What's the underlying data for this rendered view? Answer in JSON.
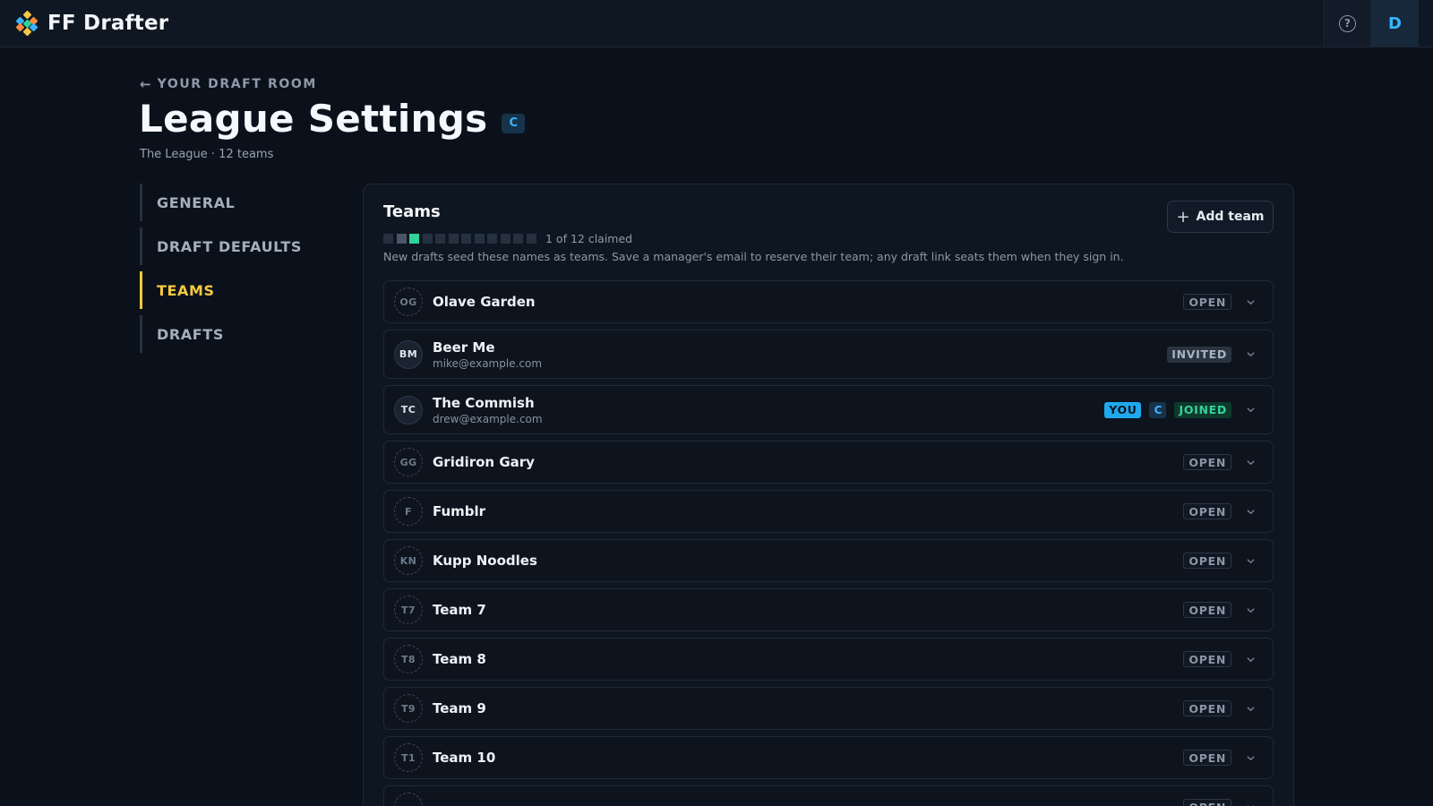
{
  "app": {
    "name": "FF Drafter",
    "avatar_initial": "D",
    "help_glyph": "?",
    "brand_colors": [
      "#ff8a3d",
      "#3cb2ff",
      "#f5c842",
      "#2fd398"
    ]
  },
  "header": {
    "back_label": "YOUR DRAFT ROOM",
    "back_icon": "arrow-left-icon",
    "title": "League Settings",
    "title_badge": "C",
    "subtitle": "The League · 12 teams"
  },
  "nav": {
    "items": [
      {
        "label": "GENERAL",
        "active": false
      },
      {
        "label": "DRAFT DEFAULTS",
        "active": false
      },
      {
        "label": "TEAMS",
        "active": true
      },
      {
        "label": "DRAFTS",
        "active": false
      }
    ]
  },
  "teams_panel": {
    "title": "Teams",
    "add_button_label": "Add team",
    "claimed_text": "1 of 12 claimed",
    "claimed_count": 1,
    "total_teams": 12,
    "help_text": "New drafts seed these names as teams. Save a manager's email to reserve their team; any draft link seats them when they sign in.",
    "teams": [
      {
        "initials": "OG",
        "name": "Olave Garden",
        "email": "",
        "status": "OPEN",
        "you": false,
        "commish": false
      },
      {
        "initials": "BM",
        "name": "Beer Me",
        "email": "mike@example.com",
        "status": "INVITED",
        "you": false,
        "commish": false
      },
      {
        "initials": "TC",
        "name": "The Commish",
        "email": "drew@example.com",
        "status": "JOINED",
        "you": true,
        "commish": true
      },
      {
        "initials": "GG",
        "name": "Gridiron Gary",
        "email": "",
        "status": "OPEN",
        "you": false,
        "commish": false
      },
      {
        "initials": "F",
        "name": "Fumblr",
        "email": "",
        "status": "OPEN",
        "you": false,
        "commish": false
      },
      {
        "initials": "KN",
        "name": "Kupp Noodles",
        "email": "",
        "status": "OPEN",
        "you": false,
        "commish": false
      },
      {
        "initials": "T7",
        "name": "Team 7",
        "email": "",
        "status": "OPEN",
        "you": false,
        "commish": false
      },
      {
        "initials": "T8",
        "name": "Team 8",
        "email": "",
        "status": "OPEN",
        "you": false,
        "commish": false
      },
      {
        "initials": "T9",
        "name": "Team 9",
        "email": "",
        "status": "OPEN",
        "you": false,
        "commish": false
      },
      {
        "initials": "T1",
        "name": "Team 10",
        "email": "",
        "status": "OPEN",
        "you": false,
        "commish": false
      },
      {
        "initials": "",
        "name": "",
        "email": "",
        "status": "OPEN",
        "you": false,
        "commish": false
      }
    ],
    "you_label": "YOU",
    "commish_label": "C"
  }
}
